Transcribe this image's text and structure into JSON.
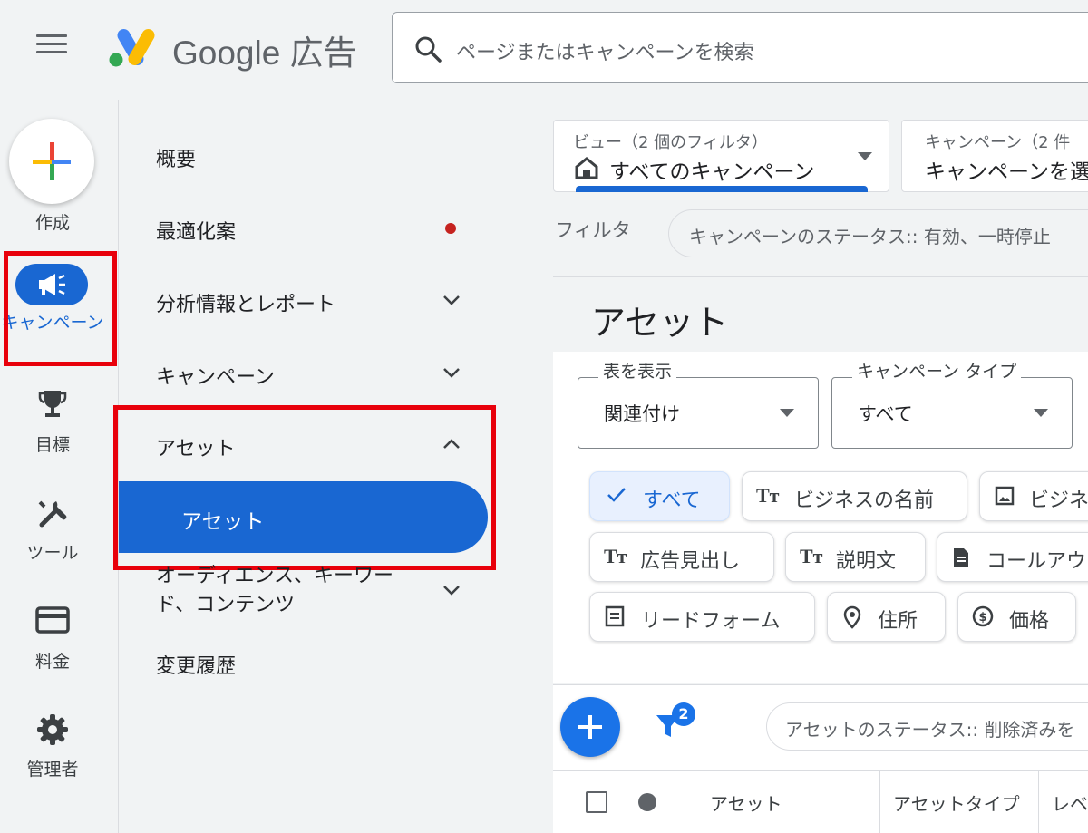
{
  "header": {
    "brand": "Google 広告",
    "search_placeholder": "ページまたはキャンペーンを検索"
  },
  "rail": {
    "create": "作成",
    "campaigns": "キャンペーン",
    "goals": "目標",
    "tools": "ツール",
    "billing": "料金",
    "admin": "管理者"
  },
  "nav": {
    "overview": "概要",
    "recommendations": "最適化案",
    "insights": "分析情報とレポート",
    "campaigns": "キャンペーン",
    "assets": "アセット",
    "assets_sub": "アセット",
    "audiences": "オーディエンス、キーワード、コンテンツ",
    "change_history": "変更履歴"
  },
  "view_selector": {
    "label": "ビュー（2 個のフィルタ）",
    "value": "すべてのキャンペーン"
  },
  "campaign_selector": {
    "label": "キャンペーン（2 件",
    "value": "キャンペーンを選"
  },
  "filter": {
    "label": "フィルタ",
    "chip": "キャンペーンのステータス:: 有効、一時停止"
  },
  "page_title": "アセット",
  "table_view": {
    "label": "表を表示",
    "value": "関連付け"
  },
  "campaign_type": {
    "label": "キャンペーン タイプ",
    "value": "すべて"
  },
  "chips": {
    "all": "すべて",
    "business_name": "ビジネスの名前",
    "business_logo": "ビジネ",
    "headline": "広告見出し",
    "description": "説明文",
    "callout": "コールアウ",
    "lead_form": "リードフォーム",
    "location": "住所",
    "price": "価格"
  },
  "toolbar": {
    "filter_count": "2",
    "status_chip": "アセットのステータス:: 削除済みを"
  },
  "table": {
    "col_asset": "アセット",
    "col_asset_type": "アセットタイプ",
    "col_level": "レベ"
  },
  "colors": {
    "accent": "#1967d2",
    "highlight_box": "#e8000b",
    "background": "#f1f3f4"
  }
}
